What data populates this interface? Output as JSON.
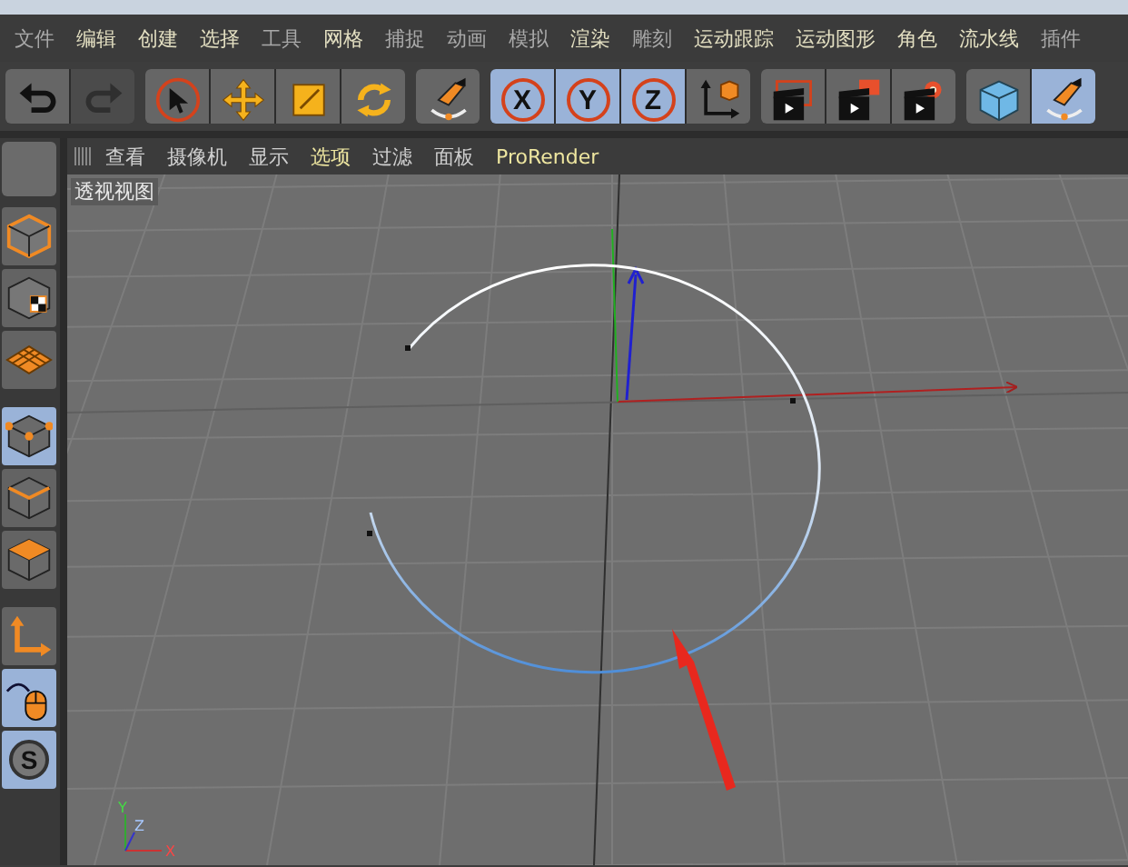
{
  "menu_bar": [
    {
      "label": "文件",
      "dimmed": true
    },
    {
      "label": "编辑",
      "dimmed": false
    },
    {
      "label": "创建",
      "dimmed": false
    },
    {
      "label": "选择",
      "dimmed": false
    },
    {
      "label": "工具",
      "dimmed": true
    },
    {
      "label": "网格",
      "dimmed": false
    },
    {
      "label": "捕捉",
      "dimmed": true
    },
    {
      "label": "动画",
      "dimmed": true
    },
    {
      "label": "模拟",
      "dimmed": true
    },
    {
      "label": "渲染",
      "dimmed": false
    },
    {
      "label": "雕刻",
      "dimmed": true
    },
    {
      "label": "运动跟踪",
      "dimmed": false
    },
    {
      "label": "运动图形",
      "dimmed": false
    },
    {
      "label": "角色",
      "dimmed": false
    },
    {
      "label": "流水线",
      "dimmed": false
    },
    {
      "label": "插件",
      "dimmed": true
    }
  ],
  "toolbar": [
    {
      "items": [
        {
          "kind": "undo",
          "selected": false,
          "disabled": false
        },
        {
          "kind": "redo",
          "selected": false,
          "disabled": true
        }
      ]
    },
    {
      "items": [
        {
          "kind": "select",
          "selected": false,
          "disabled": false
        },
        {
          "kind": "move",
          "selected": false,
          "disabled": false
        },
        {
          "kind": "scale",
          "selected": false,
          "disabled": false
        },
        {
          "kind": "rotate",
          "selected": false,
          "disabled": false
        }
      ]
    },
    {
      "items": [
        {
          "kind": "pen",
          "selected": false,
          "disabled": false
        }
      ]
    },
    {
      "items": [
        {
          "kind": "axis-x",
          "label": "X",
          "selected": true,
          "disabled": false
        },
        {
          "kind": "axis-y",
          "label": "Y",
          "selected": true,
          "disabled": false
        },
        {
          "kind": "axis-z",
          "label": "Z",
          "selected": true,
          "disabled": false
        },
        {
          "kind": "coords",
          "selected": false,
          "disabled": false
        }
      ]
    },
    {
      "items": [
        {
          "kind": "render-region",
          "selected": false,
          "disabled": false
        },
        {
          "kind": "render-view",
          "selected": false,
          "disabled": false
        },
        {
          "kind": "render-settings",
          "selected": false,
          "disabled": false
        }
      ]
    },
    {
      "items": [
        {
          "kind": "cube",
          "selected": false,
          "disabled": false
        },
        {
          "kind": "pen",
          "selected": true,
          "disabled": false
        }
      ]
    }
  ],
  "side_toolbar": [
    {
      "kind": "model",
      "selected": false
    },
    {
      "kind": "texture",
      "selected": false
    },
    {
      "kind": "workplane",
      "selected": false
    },
    {
      "kind": "points",
      "selected": true
    },
    {
      "kind": "edges",
      "selected": false
    },
    {
      "kind": "polygons",
      "selected": false
    },
    {
      "kind": "axis",
      "selected": false
    },
    {
      "kind": "mouse",
      "selected": true
    },
    {
      "kind": "snap",
      "label": "S",
      "selected": true
    }
  ],
  "viewport": {
    "menu": [
      {
        "label": "查看",
        "highlighted": false
      },
      {
        "label": "摄像机",
        "highlighted": false
      },
      {
        "label": "显示",
        "highlighted": false
      },
      {
        "label": "选项",
        "highlighted": true
      },
      {
        "label": "过滤",
        "highlighted": false
      },
      {
        "label": "面板",
        "highlighted": false
      },
      {
        "label": "ProRender",
        "highlighted": true
      }
    ],
    "label": "透视视图",
    "axis_labels": [
      "Y",
      "Z",
      "X"
    ]
  }
}
